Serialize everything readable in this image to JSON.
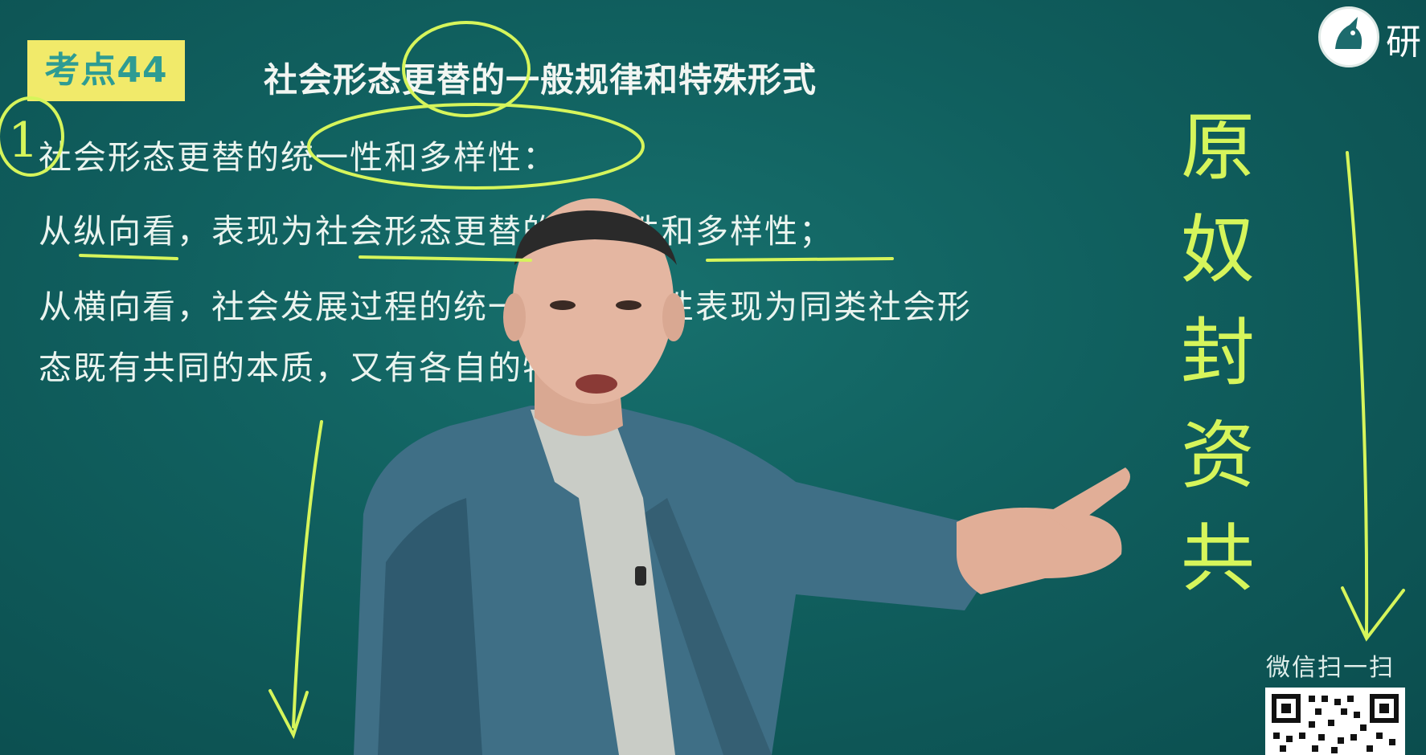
{
  "slide": {
    "badge": "考点44",
    "title": "社会形态更替的一般规律和特殊形式",
    "lines": [
      "社会形态更替的统一性和多样性：",
      "从纵向看，表现为社会形态更替的统一性和多样性；",
      "从横向看，社会发展过程的统一性和多样性表现为同类社会形",
      "态既有共同的本质，又有各自的特点"
    ]
  },
  "annotations": {
    "number": "1",
    "vertical_chars": [
      "原",
      "奴",
      "封",
      "资",
      "共"
    ]
  },
  "overlay": {
    "logo_text": "研",
    "wechat_text": "微信扫一扫"
  },
  "colors": {
    "board": "#105f5e",
    "badge": "#f1ea6a",
    "badge_text": "#2e9c93",
    "chalk": "#d6f55b",
    "text": "#eaf4ef"
  }
}
